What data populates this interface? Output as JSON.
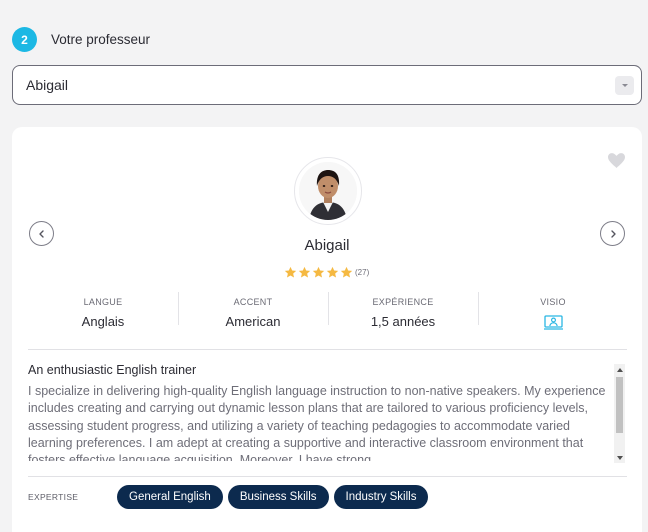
{
  "step": {
    "number": "2",
    "title": "Votre professeur"
  },
  "teacher_select": {
    "value": "Abigail"
  },
  "teacher": {
    "name": "Abigail",
    "rating_count": "(27)",
    "stars": 5,
    "stats": [
      {
        "label": "LANGUE",
        "value": "Anglais"
      },
      {
        "label": "ACCENT",
        "value": "American"
      },
      {
        "label": "EXPÉRIENCE",
        "value": "1,5 années"
      },
      {
        "label": "VISIO",
        "icon": "video-call-icon"
      }
    ],
    "bio_title": "An enthusiastic English trainer",
    "bio_text": "I specialize in delivering high-quality English language instruction to non-native speakers. My experience includes creating and carrying out dynamic lesson plans that are tailored to various proficiency levels, assessing student progress, and utilizing a variety of teaching pedagogies to accommodate varied learning preferences. I am adept at creating a supportive and interactive classroom environment that fosters effective language acquisition. Moreover, I have strong",
    "expertise_label": "EXPERTISE",
    "expertise": [
      "General English",
      "Business Skills",
      "Industry Skills"
    ]
  },
  "icons": {
    "favorite": "heart-icon",
    "prev": "chevron-left-icon",
    "next": "chevron-right-icon",
    "star": "star-icon"
  },
  "colors": {
    "accent": "#1cb8e4",
    "chip": "#0c2a4e",
    "star": "#f5b942"
  }
}
